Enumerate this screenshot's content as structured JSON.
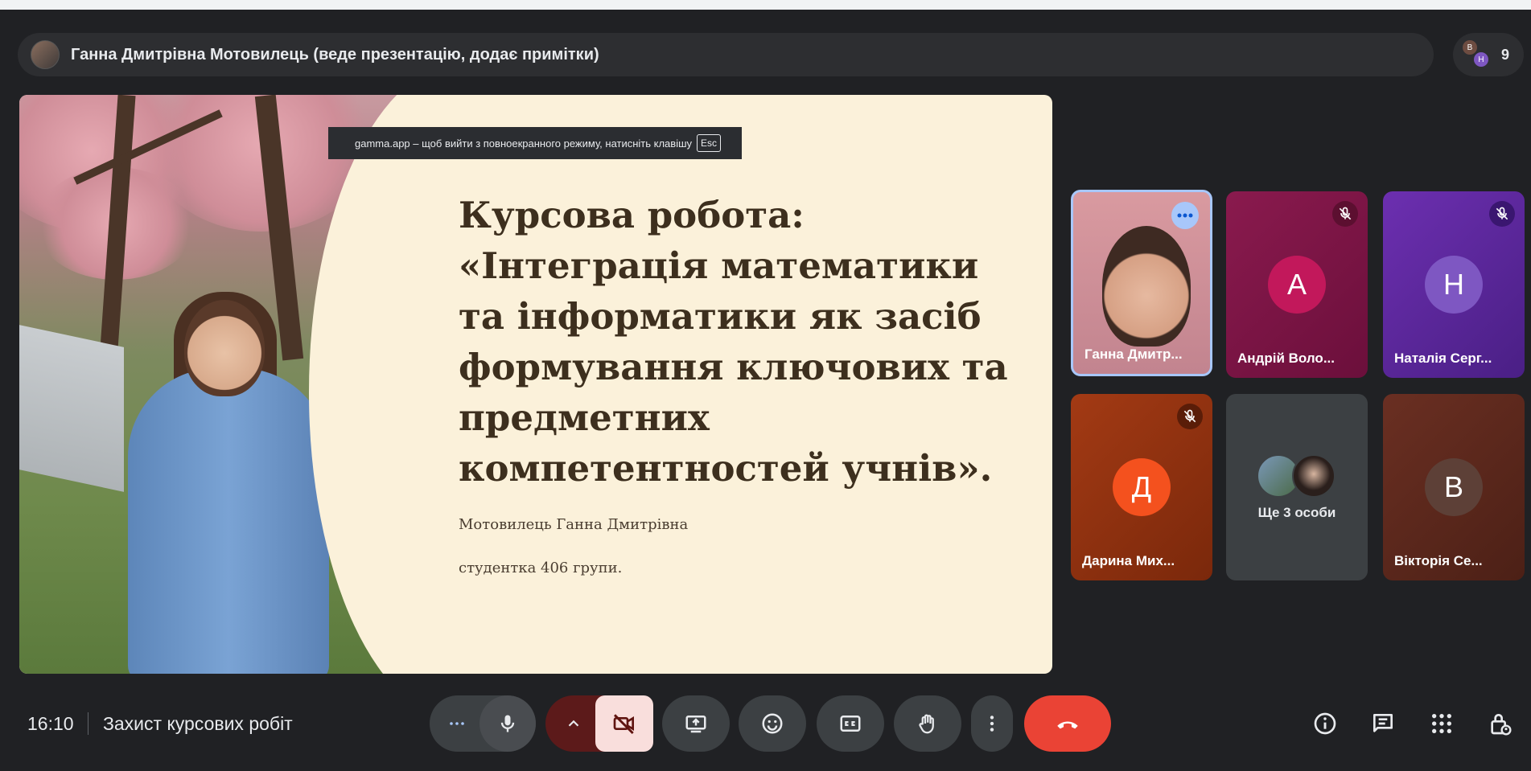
{
  "presenter": {
    "text": "Ганна Дмитрівна Мотовилець (веде презентацію, додає примітки)"
  },
  "people_chip": {
    "count": "9",
    "mini_avatars": [
      "B",
      "Н"
    ]
  },
  "slide": {
    "title": "Курсова робота: «Інтеграція математики та інформатики як засіб формування ключових та предметних компетентностей учнів».",
    "author": "Мотовилець Ганна Дмитрівна",
    "group": "студентка 406 групи."
  },
  "fullscreen_banner": {
    "text": "gamma.app – щоб вийти з повноекранного режиму, натисніть клавішу",
    "key": "Esc"
  },
  "participants": [
    {
      "name": "Ганна Дмитр...",
      "type": "video",
      "speaking": true
    },
    {
      "name": "Андрій Воло...",
      "letter": "А",
      "color": "#c2185b",
      "muted": true
    },
    {
      "name": "Наталія Серг...",
      "letter": "Н",
      "color": "#7e57c2",
      "muted": true
    },
    {
      "name": "Дарина Мих...",
      "letter": "Д",
      "color": "#f4511e",
      "muted": true
    },
    {
      "name": "Ще 3 особи",
      "type": "others"
    },
    {
      "name": "Вікторія Се...",
      "letter": "В",
      "color": "#5d4037",
      "muted": false
    }
  ],
  "footer": {
    "time": "16:10",
    "meeting_name": "Захист курсових робіт"
  },
  "colors": {
    "background": "#202124",
    "leave_button": "#ea4335",
    "cam_off_bg": "#f9dedc",
    "active_tile_border": "#a8c7fa"
  },
  "icons": [
    "more-horiz-icon",
    "mic-icon",
    "chevron-up-icon",
    "videocam-off-icon",
    "present-screen-icon",
    "emoji-icon",
    "captions-icon",
    "raise-hand-icon",
    "more-vert-icon",
    "call-end-icon",
    "info-icon",
    "chat-icon",
    "apps-icon",
    "host-controls-icon"
  ]
}
